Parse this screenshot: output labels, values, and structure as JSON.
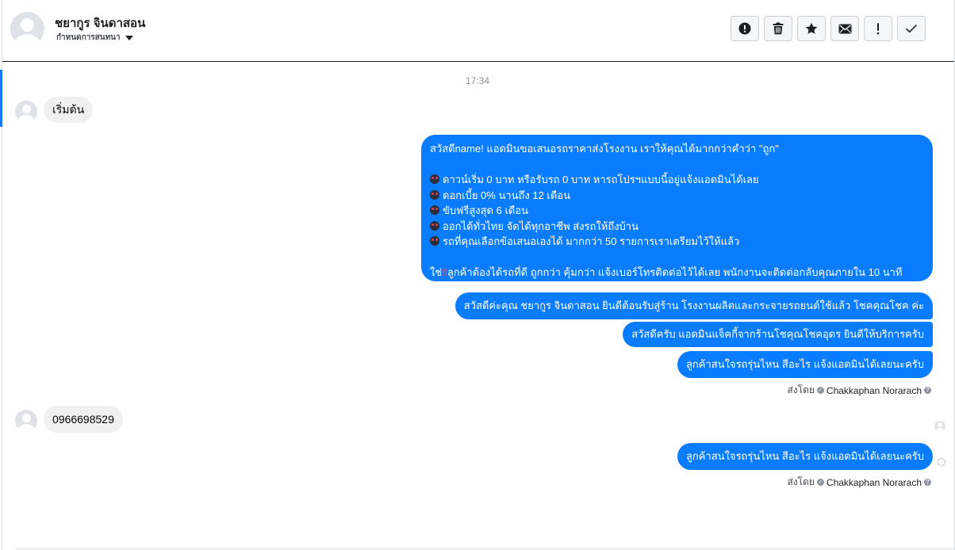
{
  "contact": {
    "name": "ชยากูร จินดาสอน",
    "status": "กำหนดการสนทนา"
  },
  "toolbar": {
    "buttons": [
      {
        "name": "spam-button",
        "icon": "exclamation-circle-icon"
      },
      {
        "name": "delete-button",
        "icon": "trash-icon"
      },
      {
        "name": "star-button",
        "icon": "star-icon"
      },
      {
        "name": "mark-unread-button",
        "icon": "envelope-icon"
      },
      {
        "name": "important-button",
        "icon": "exclamation-icon"
      },
      {
        "name": "mark-done-button",
        "icon": "check-icon"
      }
    ]
  },
  "conversation": {
    "timestamp": "17:34",
    "incoming_1": "เริ่มต้น",
    "outgoing_long": {
      "line1": "สวัสดีname! แอดมินขอเสนอรถราคาส่งโรงงาน เราให้คุณได้มากกว่าคำว่า \"ถูก\"",
      "bullets": [
        "ดาวน์เริ่ม 0 บาท หรือรับรถ 0 บาท หารถโปรฯแบบนี้อยู่แจ้งแอดมินได้เลย",
        "ดอกเบี้ย 0% นานถึง 12 เดือน",
        "ขับฟรีสูงสุด 6 เดือน",
        "ออกได้ทั่วไทย จัดได้ทุกอาชีพ ส่งรถให้ถึงบ้าน",
        "รถที่คุณเลือกข้อเสนอเองได้ มากกว่า 50 รายการเราเตรียมไว้ให้แล้ว"
      ],
      "closing_prefix": "ใช่",
      "closing": "ลูกค้าต้องได้รถที่ดี ถูกกว่า คุ้มกว่า แจ้งเบอร์โทรติดต่อไว้ได้เลย พนักงานจะติดต่อกลับคุณภายใน 10 นาที"
    },
    "outgoing_2": "สวัสดีค่ะคุณ ชยากูร จินดาสอน ยินดีต้อนรับสู่ร้าน โรงงานผลิตและกระจายรถยนต์ใช้แล้ว โชคคุณโชค ค่ะ",
    "outgoing_3": "สวัสดีครับ แอดมินแจ็คกี้จากร้านโชคุณโชคอุดร ยินดีให้บริการครับ",
    "outgoing_4": "ลูกค้าสนใจรถรุ่นไหน สีอะไร แจ้งแอดมินได้เลยนะครับ",
    "sent_by_label": "ส่งโดย",
    "sent_by_agent": "Chakkaphan Norarach",
    "incoming_2": "0966698529",
    "outgoing_5": "ลูกค้าสนใจรถรุ่นไหน สีอะไร แจ้งแอดมินได้เลยนะครับ"
  },
  "colors": {
    "outgoing_bubble": "#0a7cff",
    "incoming_bubble": "#f1f0f0",
    "accent": "#1877f2"
  }
}
